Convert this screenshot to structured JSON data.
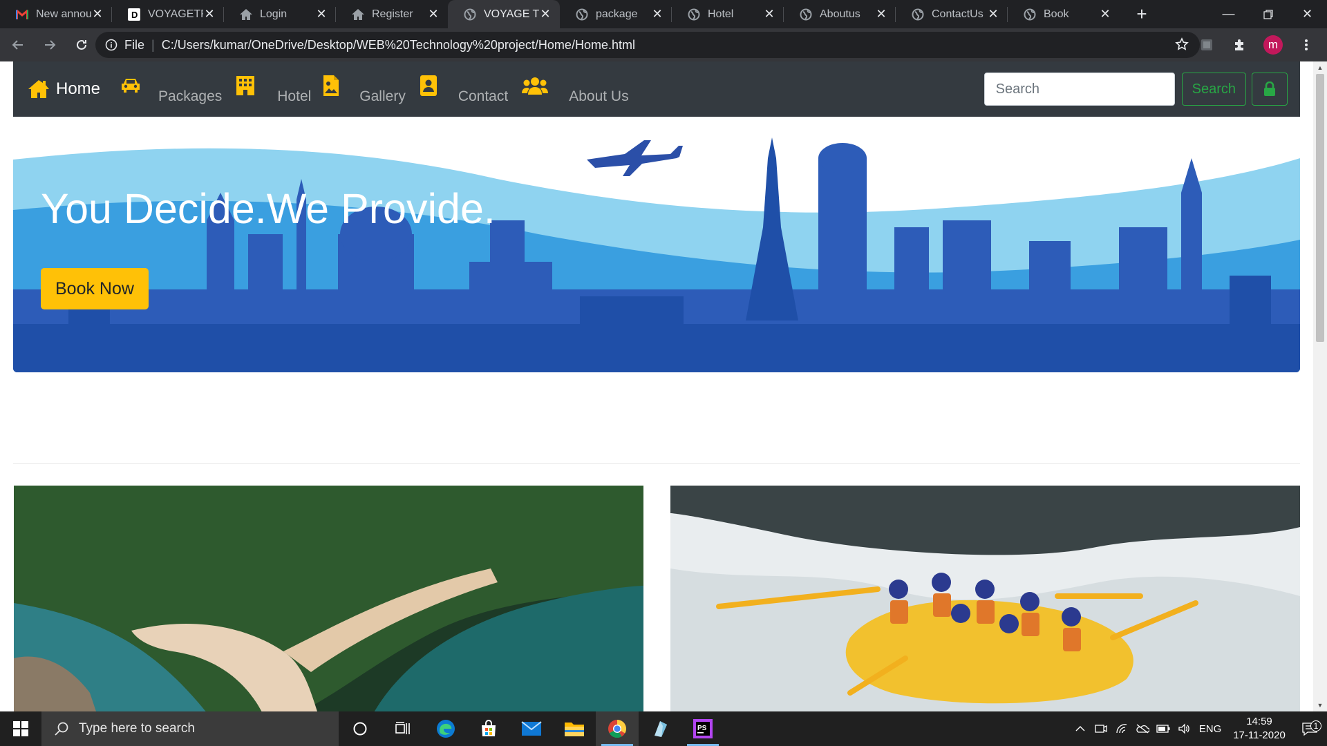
{
  "browser": {
    "tabs": [
      {
        "title": "New announ",
        "icon": "gmail-icon",
        "active": false
      },
      {
        "title": "VOYAGETRA",
        "icon": "dev-icon",
        "active": false
      },
      {
        "title": "Login",
        "icon": "home-icon",
        "active": false
      },
      {
        "title": "Register",
        "icon": "home-icon",
        "active": false
      },
      {
        "title": "VOYAGE TRA",
        "icon": "globe-icon",
        "active": true
      },
      {
        "title": "package",
        "icon": "globe-icon",
        "active": false
      },
      {
        "title": "Hotel",
        "icon": "globe-icon",
        "active": false
      },
      {
        "title": "Aboutus",
        "icon": "globe-icon",
        "active": false
      },
      {
        "title": "ContactUs",
        "icon": "globe-icon",
        "active": false
      },
      {
        "title": "Book",
        "icon": "globe-icon",
        "active": false
      }
    ],
    "address": {
      "scheme_label": "File",
      "url": "C:/Users/kumar/OneDrive/Desktop/WEB%20Technology%20project/Home/Home.html"
    },
    "profile_initial": "m"
  },
  "site": {
    "brand": "Home",
    "nav": [
      {
        "label": "Packages",
        "icon": "car-icon"
      },
      {
        "label": "Hotel",
        "icon": "building-icon"
      },
      {
        "label": "Gallery",
        "icon": "image-file-icon"
      },
      {
        "label": "Contact",
        "icon": "contact-card-icon"
      },
      {
        "label": "About Us",
        "icon": "users-icon"
      }
    ],
    "search": {
      "placeholder": "Search",
      "button": "Search"
    },
    "hero": {
      "headline": "You Decide.We Provide.",
      "cta": "Book Now"
    },
    "colors": {
      "nav_bg": "#343a40",
      "accent": "#ffc107",
      "success": "#28a745",
      "hero_dark": "#1f4fa8",
      "hero_light": "#8fd3f0"
    }
  },
  "taskbar": {
    "search_placeholder": "Type here to search",
    "language": "ENG",
    "time": "14:59",
    "date": "17-11-2020",
    "notification_count": "1"
  }
}
